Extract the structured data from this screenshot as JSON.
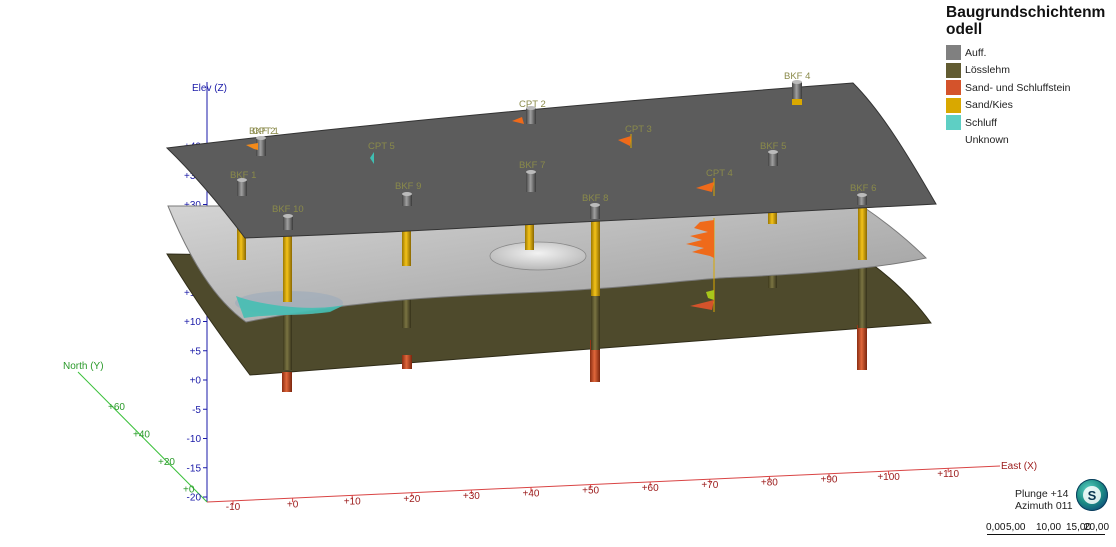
{
  "legend": {
    "title": "Baugrundschichtenmodell",
    "items": [
      {
        "label": "Auff.",
        "color": "#808080"
      },
      {
        "label": "Lösslehm",
        "color": "#625c32"
      },
      {
        "label": "Sand- und Schluffstein",
        "color": "#d4532b"
      },
      {
        "label": "Sand/Kies",
        "color": "#d9a800"
      },
      {
        "label": "Schluff",
        "color": "#5ecfc4"
      },
      {
        "label": "Unknown",
        "color": "#ffffff"
      }
    ]
  },
  "axes": {
    "elev": {
      "label": "Elev (Z)",
      "ticks": [
        "+40",
        "+35",
        "+30",
        "+25",
        "+20",
        "+15",
        "+10",
        "+5",
        "+0",
        "-5",
        "-10",
        "-15",
        "-20"
      ],
      "color": "#1a1aa8"
    },
    "east": {
      "label": "East (X)",
      "ticks": [
        "-10",
        "+0",
        "+10",
        "+20",
        "+30",
        "+40",
        "+50",
        "+60",
        "+70",
        "+80",
        "+90",
        "+100",
        "+110"
      ],
      "color": "#9b1a1a"
    },
    "north": {
      "label": "North (Y)",
      "ticks": [
        "+60",
        "+40",
        "+20",
        "+0"
      ],
      "color": "#2a9a2a"
    }
  },
  "boreholes": [
    "BKF 1",
    "BKF 2",
    "BKF 4",
    "BKF 5",
    "BKF 6",
    "BKF 7",
    "BKF 8",
    "BKF 9",
    "BKF 10"
  ],
  "cpts": [
    "CPT 1",
    "CPT 2",
    "CPT 3",
    "CPT 4",
    "CPT 5"
  ],
  "view": {
    "plunge": "Plunge +14",
    "azimuth": "Azimuth 011",
    "compass_letter": "S"
  },
  "scale": {
    "labels": [
      "0,00",
      "5,00",
      "10,00",
      "15,00",
      "20,00"
    ]
  }
}
